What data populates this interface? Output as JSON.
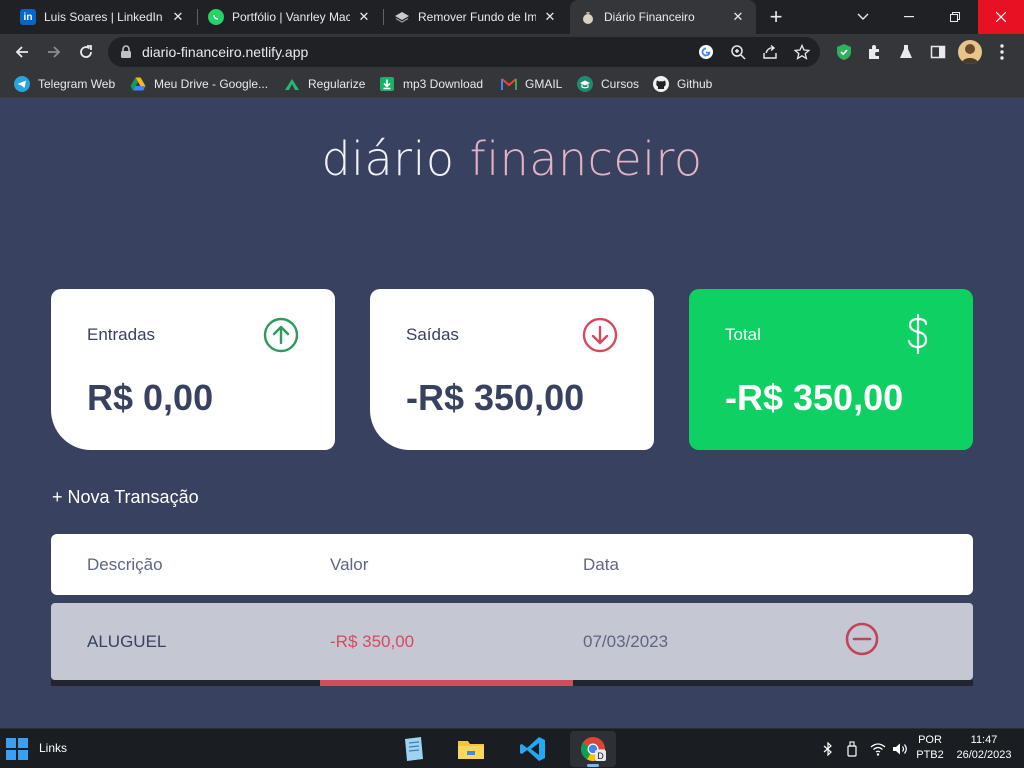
{
  "browser": {
    "tabs": [
      {
        "title": "Luis Soares | LinkedIn",
        "icon": "linkedin-icon",
        "active": false
      },
      {
        "title": "Portfólio | Vanrley Mace",
        "icon": "whatsapp-icon",
        "active": false
      },
      {
        "title": "Remover Fundo de Ima",
        "icon": "layers-icon",
        "active": false
      },
      {
        "title": "Diário Financeiro",
        "icon": "money-bag-icon",
        "active": true
      }
    ],
    "new_tab_label": "+",
    "url": "diario-financeiro.netlify.app",
    "bookmarks": [
      {
        "label": "Telegram Web",
        "icon": "telegram-icon"
      },
      {
        "label": "Meu Drive - Google...",
        "icon": "google-drive-icon"
      },
      {
        "label": "Regularize",
        "icon": "regularize-icon"
      },
      {
        "label": "mp3 Download",
        "icon": "download-icon"
      },
      {
        "label": "GMAIL",
        "icon": "gmail-icon"
      },
      {
        "label": "Cursos",
        "icon": "graduation-cap-icon"
      },
      {
        "label": "Github",
        "icon": "github-icon"
      }
    ]
  },
  "app": {
    "brand_word1": "diário",
    "brand_word2": "financeiro",
    "cards": {
      "income": {
        "label": "Entradas",
        "amount": "R$ 0,00",
        "icon": "arrow-up-circle-icon"
      },
      "expense": {
        "label": "Saídas",
        "amount": "-R$ 350,00",
        "icon": "arrow-down-circle-icon"
      },
      "total": {
        "label": "Total",
        "amount": "-R$ 350,00",
        "icon": "dollar-sign-icon"
      }
    },
    "new_transaction_label": "+ Nova Transação",
    "table": {
      "headers": {
        "description": "Descrição",
        "value": "Valor",
        "date": "Data"
      },
      "rows": [
        {
          "description": "ALUGUEL",
          "value": "-R$ 350,00",
          "date": "07/03/2023",
          "action_icon": "minus-circle-icon"
        }
      ]
    }
  },
  "taskbar": {
    "links_label": "Links",
    "language": "POR",
    "keyboard": "PTB2",
    "time": "11:47",
    "date": "26/02/2023"
  },
  "colors": {
    "page_bg": "#384160",
    "brand_accent": "#e3b3c5",
    "income_green": "#0fd163",
    "expense_red": "#d64a5f",
    "card_bg": "#ffffff"
  }
}
